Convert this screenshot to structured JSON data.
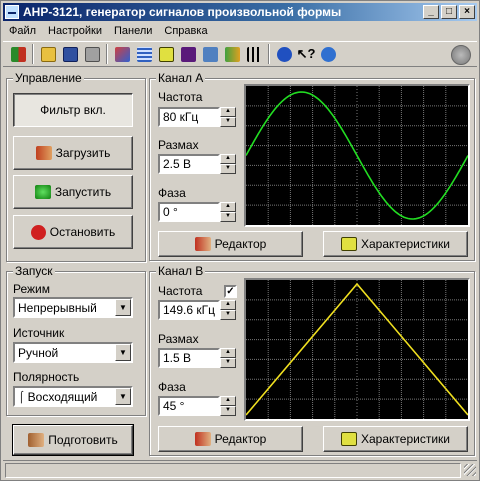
{
  "window": {
    "title": "АНР-3121, генератор сигналов произвольной формы"
  },
  "menu": [
    "Файл",
    "Настройки",
    "Панели",
    "Справка"
  ],
  "controls": {
    "title": "Управление",
    "filter_label": "Фильтр вкл.",
    "load_label": "Загрузить",
    "start_label": "Запустить",
    "stop_label": "Остановить"
  },
  "launch": {
    "title": "Запуск",
    "mode_label": "Режим",
    "mode_value": "Непрерывный",
    "source_label": "Источник",
    "source_value": "Ручной",
    "polarity_label": "Полярность",
    "polarity_value": "Восходящий"
  },
  "prepare_label": "Подготовить",
  "channel_a": {
    "title": "Канал A",
    "freq_label": "Частота",
    "freq_value": "80 кГц",
    "amp_label": "Размах",
    "amp_value": "2.5 В",
    "phase_label": "Фаза",
    "phase_value": "0 °",
    "editor_label": "Редактор",
    "chars_label": "Характеристики",
    "trace_color": "#22dd22",
    "waveform": "sine"
  },
  "channel_b": {
    "title": "Канал B",
    "freq_label": "Частота",
    "freq_checked": true,
    "freq_value": "149.6 кГц",
    "amp_label": "Размах",
    "amp_value": "1.5 В",
    "phase_label": "Фаза",
    "phase_value": "45 °",
    "editor_label": "Редактор",
    "chars_label": "Характеристики",
    "trace_color": "#f0e020",
    "waveform": "triangle"
  },
  "icons": [
    "app-icon",
    "exit-icon",
    "open-folder-icon",
    "save-icon",
    "print-icon",
    "waveform-icon",
    "table-icon",
    "characteristics-icon",
    "spectrum-icon",
    "settings-icon",
    "export-icon",
    "pulse-icon",
    "help-icon",
    "context-help-icon",
    "info-icon",
    "refresh-icon"
  ]
}
